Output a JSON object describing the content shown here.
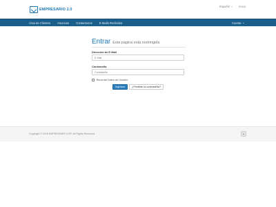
{
  "brand": {
    "name": "EMPRESARIO 2.0"
  },
  "top_links": {
    "language": "Español",
    "home": "Inicio"
  },
  "nav": {
    "items": [
      "Área de Clientes",
      "Anuncios",
      "Contactenos",
      "E-Mails Recibidos"
    ],
    "account": "Cuenta"
  },
  "login": {
    "title": "Entrar",
    "subtitle": "Esta página está restringida",
    "email_label": "Dirección de E-Mail",
    "email_placeholder": "E-Mail",
    "password_label": "Contraseña",
    "password_placeholder": "Contraseña",
    "remember_label": "Recordar Datos de Usuario",
    "submit_label": "Ingresar",
    "forgot_label": "¿Perdiste la contraseña?"
  },
  "footer": {
    "copyright": "Copyright © 2018 EMPRESARIO 2.0®. All Rights Reserved."
  },
  "colors": {
    "brand_blue": "#1a77b7",
    "navbar": "#1a5f8c",
    "primary_button": "#2b7ebd"
  }
}
